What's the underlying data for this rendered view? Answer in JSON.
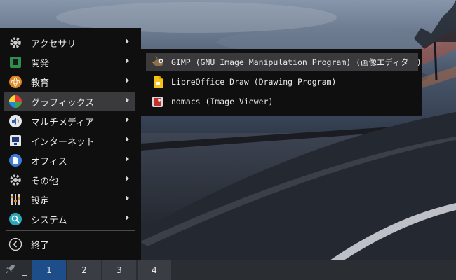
{
  "app_menu": {
    "items": [
      {
        "label": "アクセサリ",
        "icon": "accessories-icon"
      },
      {
        "label": "開発",
        "icon": "development-icon"
      },
      {
        "label": "教育",
        "icon": "education-icon"
      },
      {
        "label": "グラフィックス",
        "icon": "graphics-icon",
        "selected": true
      },
      {
        "label": "マルチメディア",
        "icon": "multimedia-icon"
      },
      {
        "label": "インターネット",
        "icon": "internet-icon"
      },
      {
        "label": "オフィス",
        "icon": "office-icon"
      },
      {
        "label": "その他",
        "icon": "other-icon"
      },
      {
        "label": "設定",
        "icon": "settings-icon"
      },
      {
        "label": "システム",
        "icon": "system-icon"
      }
    ],
    "logout": {
      "label": "終了",
      "icon": "logout-icon"
    }
  },
  "graphics_submenu": {
    "items": [
      {
        "label": "GIMP (GNU Image Manipulation Program) (画像エディター)",
        "icon": "gimp-icon",
        "selected": true
      },
      {
        "label": "LibreOffice Draw (Drawing Program)",
        "icon": "libreoffice-draw-icon"
      },
      {
        "label": "nomacs (Image Viewer)",
        "icon": "nomacs-icon"
      }
    ]
  },
  "taskbar": {
    "start_icon": "rocket-icon",
    "minimize_indicator": "_",
    "workspaces": [
      "1",
      "2",
      "3",
      "4"
    ],
    "active_workspace": "1"
  },
  "colors": {
    "menu_bg": "#0f0f10",
    "highlight": "#3a3a3c",
    "taskbar_bg": "#2a2e33",
    "active_workspace": "#1d4e89"
  }
}
